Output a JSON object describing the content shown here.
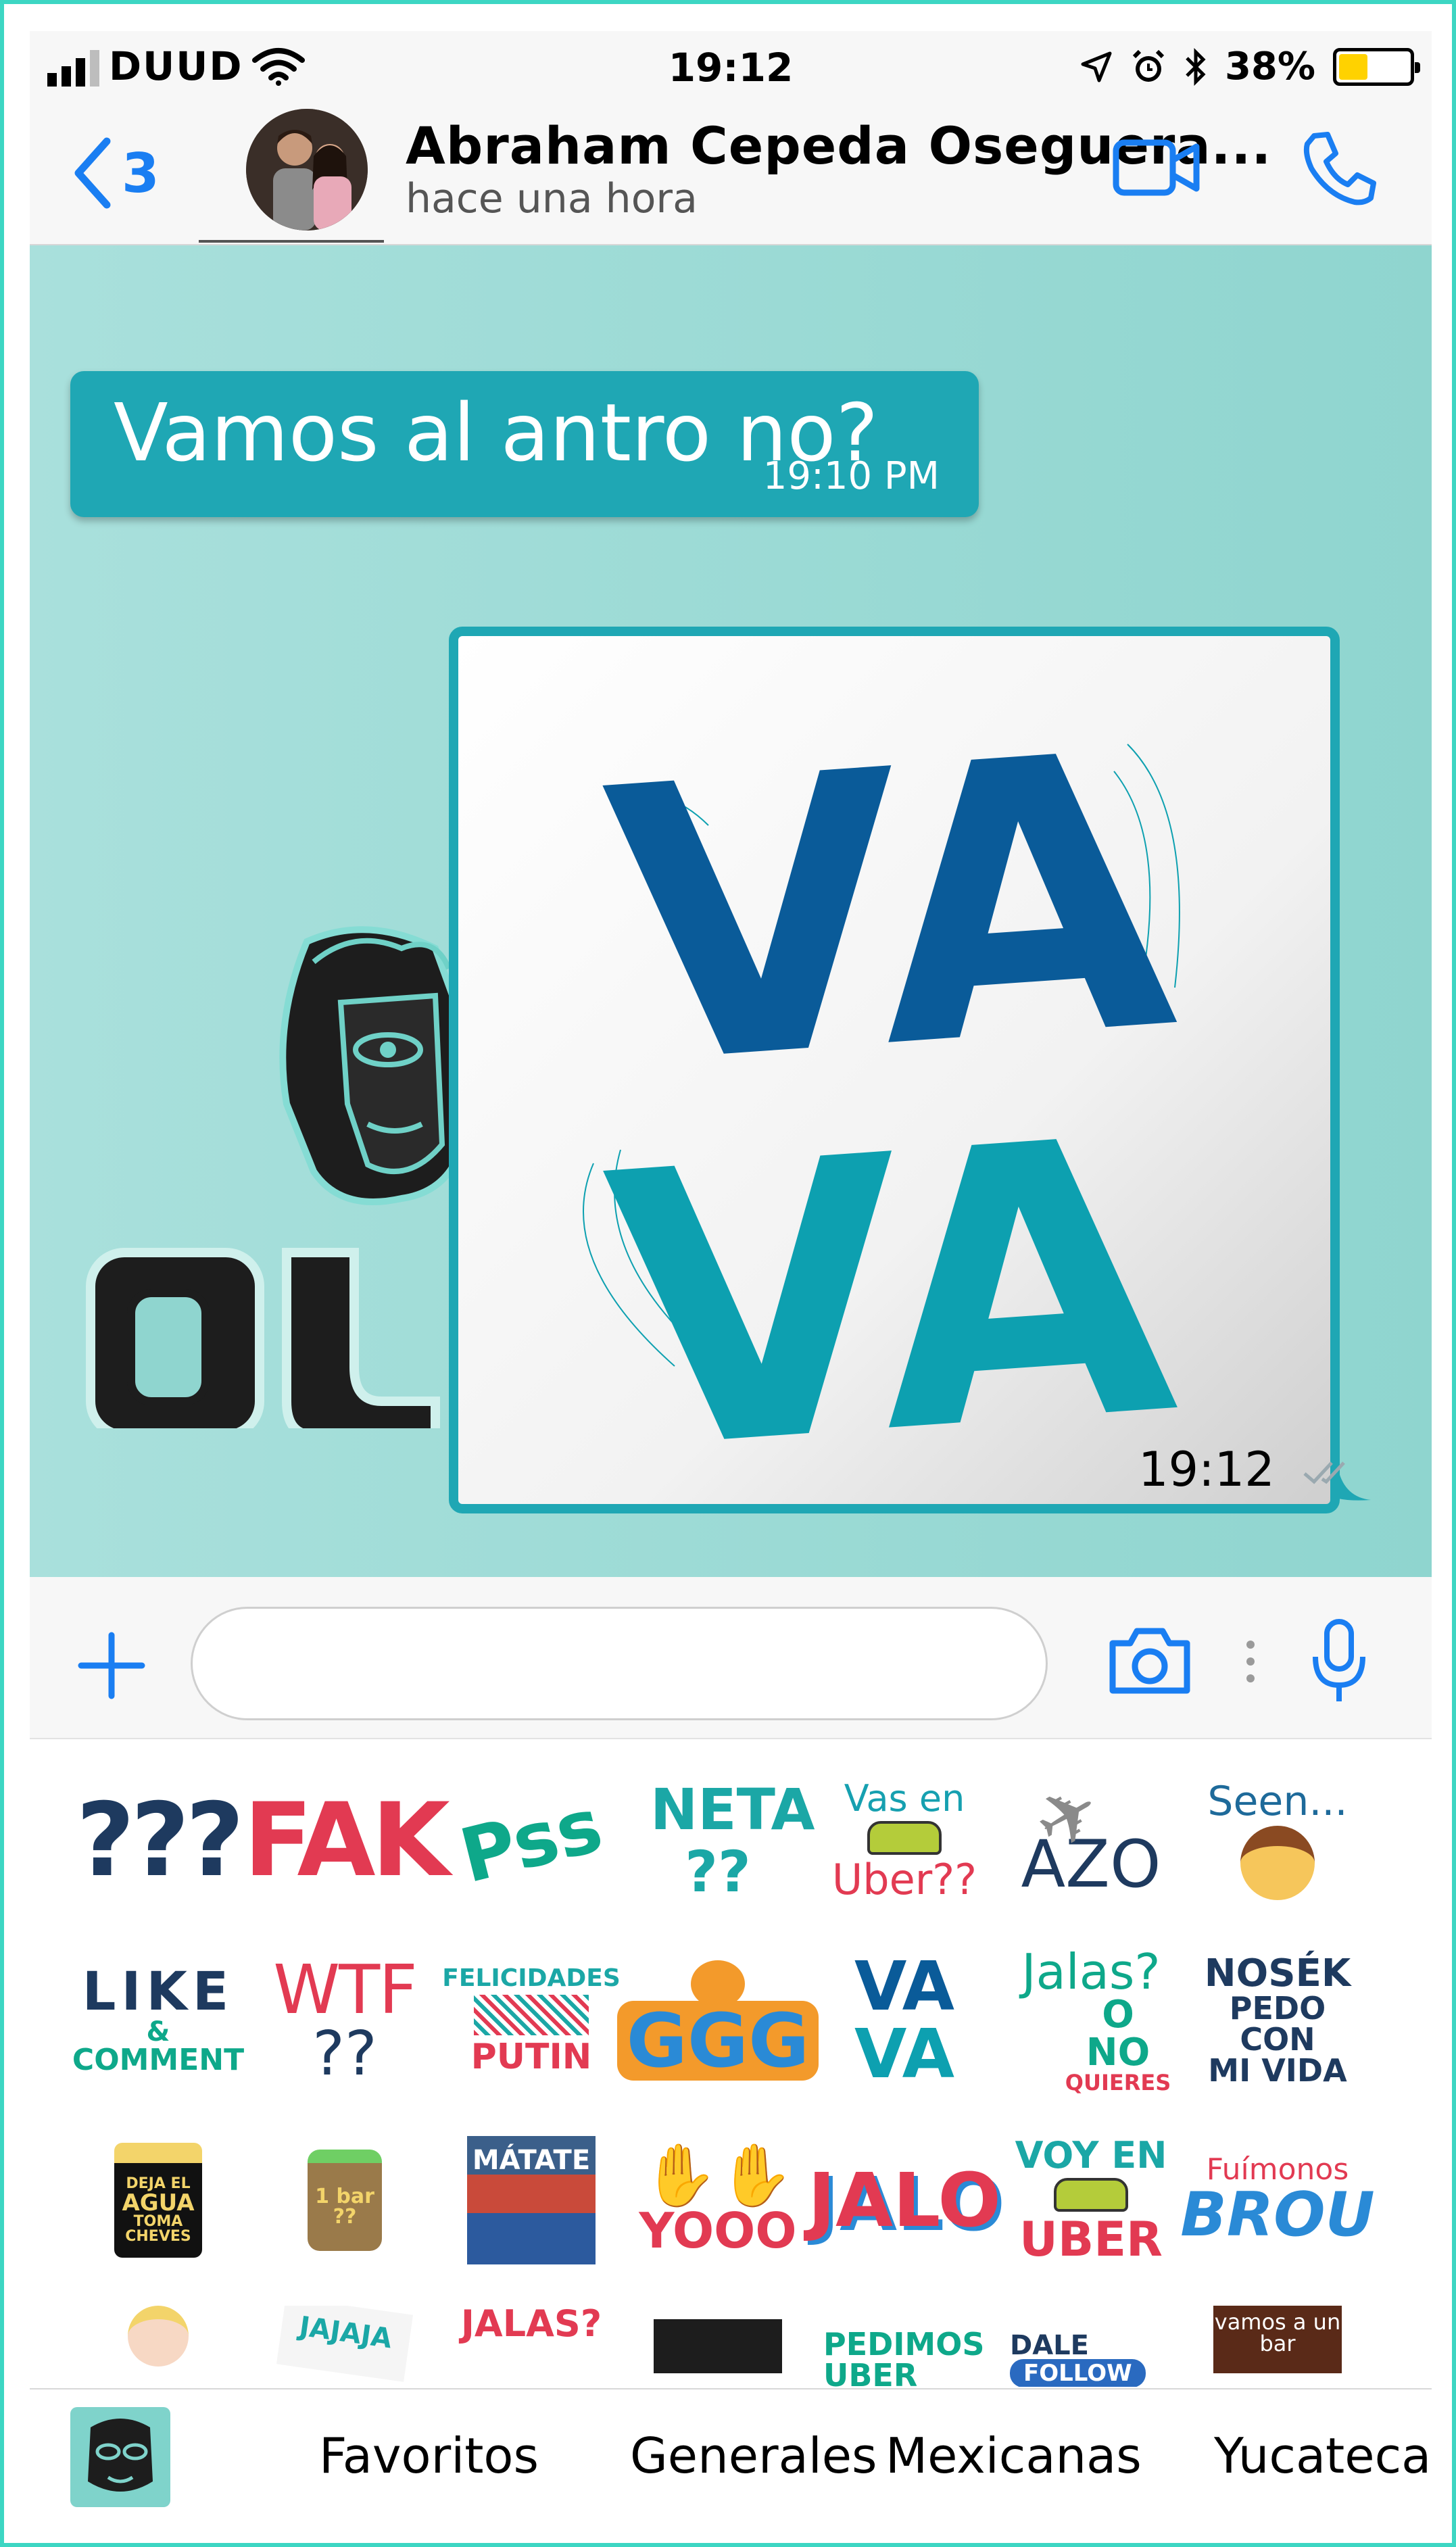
{
  "status_bar": {
    "carrier": "DUUD",
    "time": "19:12",
    "battery": "38%",
    "battery_level": 0.38,
    "icons": [
      "signal-icon",
      "wifi-icon",
      "location-icon",
      "alarm-icon",
      "bluetooth-icon",
      "battery-icon"
    ]
  },
  "header": {
    "back_count": "3",
    "contact_name": "Abraham Cepeda Oseguera...",
    "last_seen": "hace una hora",
    "icons": [
      "back-chevron-icon",
      "avatar",
      "video-call-icon",
      "phone-icon"
    ]
  },
  "chat": {
    "incoming": {
      "text": "Vamos al antro no?",
      "time": "19:10 PM"
    },
    "outgoing_sticker": {
      "line1": "VA",
      "line2": "VA",
      "time": "19:12"
    },
    "background_logo": "DU"
  },
  "composer": {
    "placeholder": "",
    "icons": [
      "add-icon",
      "camera-icon",
      "more-dots-icon",
      "microphone-icon"
    ]
  },
  "stickers": [
    {
      "id": "q",
      "text": "???"
    },
    {
      "id": "fak",
      "text": "FAK"
    },
    {
      "id": "pss",
      "text": "Pss"
    },
    {
      "id": "neta",
      "text": "NETA ??"
    },
    {
      "id": "uber",
      "text1": "Vas en",
      "text2": "Uber??"
    },
    {
      "id": "azo",
      "text": "AZO"
    },
    {
      "id": "seen",
      "text": "Seen..."
    },
    {
      "id": "like",
      "text1": "LIKE",
      "text2": "&",
      "text3": "COMMENT"
    },
    {
      "id": "wtf",
      "text1": "WTF",
      "text2": "??"
    },
    {
      "id": "putin",
      "text1": "FELICIDADES",
      "text2": "PUTIN"
    },
    {
      "id": "ggg",
      "text": "GGG"
    },
    {
      "id": "vava",
      "text1": "VA",
      "text2": "VA"
    },
    {
      "id": "jalas",
      "text1": "Jalas?",
      "text2": "O NO",
      "text3": "QUIERES"
    },
    {
      "id": "nosek",
      "text1": "NOSÉK",
      "text2": "PEDO CON",
      "text3": "MI VIDA"
    },
    {
      "id": "agua",
      "text1": "DEJA EL",
      "text2": "AGUA",
      "text3": "TOMA",
      "text4": "CHEVES"
    },
    {
      "id": "jar",
      "text": "1 bar ??"
    },
    {
      "id": "matate",
      "text": "MÁTATE"
    },
    {
      "id": "yooo",
      "text": "YOOO"
    },
    {
      "id": "jalo",
      "text": "JALO"
    },
    {
      "id": "voy",
      "text1": "VOY EN",
      "text2": "UBER"
    },
    {
      "id": "brou",
      "text1": "Fuímonos",
      "text2": "BROU"
    },
    {
      "id": "baby",
      "text": ""
    },
    {
      "id": "jajaja",
      "text": "JAJAJA"
    },
    {
      "id": "jalas2",
      "text": "JALAS?"
    },
    {
      "id": "screen",
      "text": ""
    },
    {
      "id": "pedimos",
      "text1": "PEDIMOS",
      "text2": "UBER"
    },
    {
      "id": "dale",
      "text1": "DALE",
      "text2": "FOLLOW"
    },
    {
      "id": "bar",
      "text1": "vamos a un",
      "text2": "bar"
    }
  ],
  "categories": {
    "favoritos": "Favoritos",
    "generales": "Generales",
    "mexicanas": "Mexicanas",
    "yucatecas": "Yucatecas"
  },
  "colors": {
    "accent": "#1a7ef2",
    "bubble": "#1fa7b4",
    "chat_bg": "#9ad9d4",
    "frame": "#3dd6c3",
    "sticker_dark_blue": "#0a5b99",
    "sticker_teal": "#0da0b0"
  }
}
